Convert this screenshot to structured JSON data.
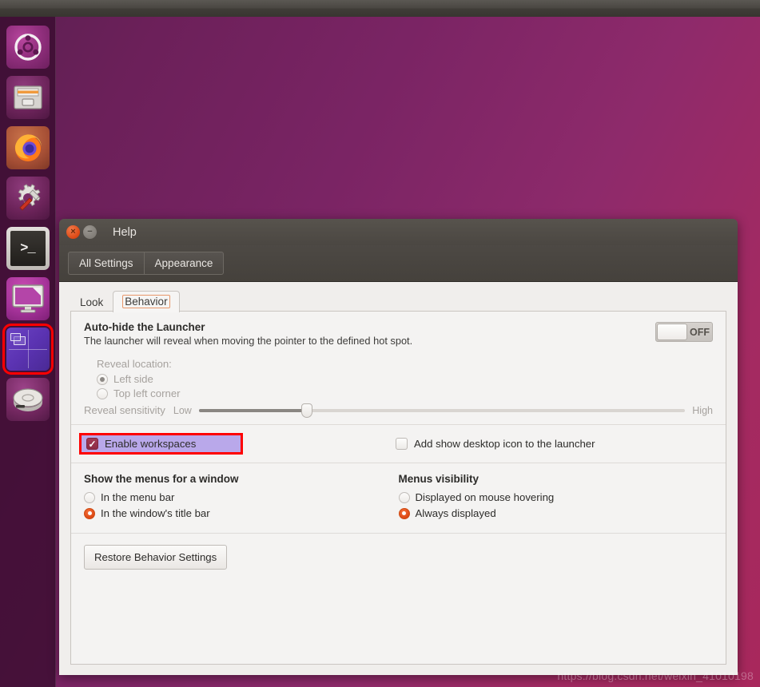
{
  "desktop": {
    "wallpaper_gradient_from": "#5c2052",
    "wallpaper_gradient_to": "#a8285c",
    "watermark": "https://blog.csdn.net/weixin_41010198"
  },
  "top_panel": {
    "background": "#4a4742"
  },
  "launcher": {
    "background": "rgba(58,12,48,0.80)",
    "items": [
      {
        "name": "ubuntu-dash",
        "label": "Ubuntu Dash Home",
        "icon": "ubuntu-logo-icon",
        "running": false,
        "highlighted": false
      },
      {
        "name": "files",
        "label": "Files",
        "icon": "file-cabinet-icon",
        "running": false,
        "highlighted": false
      },
      {
        "name": "firefox",
        "label": "Firefox Web Browser",
        "icon": "firefox-icon",
        "running": true,
        "highlighted": false
      },
      {
        "name": "settings-tools",
        "label": "Unity Tweak Tool",
        "icon": "gear-wrench-icon",
        "running": false,
        "highlighted": false
      },
      {
        "name": "terminal",
        "label": "Terminal",
        "icon": "terminal-icon",
        "running": true,
        "highlighted": false
      },
      {
        "name": "appearance",
        "label": "Appearance",
        "icon": "monitor-display-icon",
        "running": true,
        "highlighted": false
      },
      {
        "name": "workspace-switcher",
        "label": "Workspace Switcher",
        "icon": "workspace-grid-icon",
        "running": false,
        "highlighted": true
      },
      {
        "name": "disk",
        "label": "Disk",
        "icon": "hard-disk-icon",
        "running": false,
        "highlighted": false
      }
    ]
  },
  "window": {
    "title": "Help",
    "close_glyph": "×",
    "minimize_glyph": "−",
    "toolbar": {
      "all_settings_label": "All Settings",
      "appearance_label": "Appearance"
    },
    "tabs": [
      {
        "label": "Look",
        "active": false
      },
      {
        "label": "Behavior",
        "active": true
      }
    ],
    "autohide": {
      "title": "Auto-hide the Launcher",
      "description": "The launcher will reveal when moving the pointer to the defined hot spot.",
      "toggle_state": "OFF",
      "reveal_location_label": "Reveal location:",
      "reveal_options": [
        {
          "label": "Left side",
          "selected": true
        },
        {
          "label": "Top left corner",
          "selected": false
        }
      ],
      "sensitivity_label": "Reveal sensitivity",
      "sensitivity_low": "Low",
      "sensitivity_high": "High",
      "sensitivity_value": 21,
      "disabled": true
    },
    "workspaces": {
      "enable_label": "Enable workspaces",
      "enable_checked": true,
      "highlight_color": "#b9a8ea",
      "annotation_color": "#ff0000",
      "desktop_icon_label": "Add show desktop icon to the launcher",
      "desktop_icon_checked": false
    },
    "menus": {
      "show_menus_title": "Show the menus for a window",
      "show_menus_options": [
        {
          "label": "In the menu bar",
          "selected": false
        },
        {
          "label": "In the window's title bar",
          "selected": true
        }
      ],
      "visibility_title": "Menus visibility",
      "visibility_options": [
        {
          "label": "Displayed on mouse hovering",
          "selected": false
        },
        {
          "label": "Always displayed",
          "selected": true
        }
      ]
    },
    "restore_button_label": "Restore Behavior Settings",
    "accent_color": "#dd4814"
  }
}
